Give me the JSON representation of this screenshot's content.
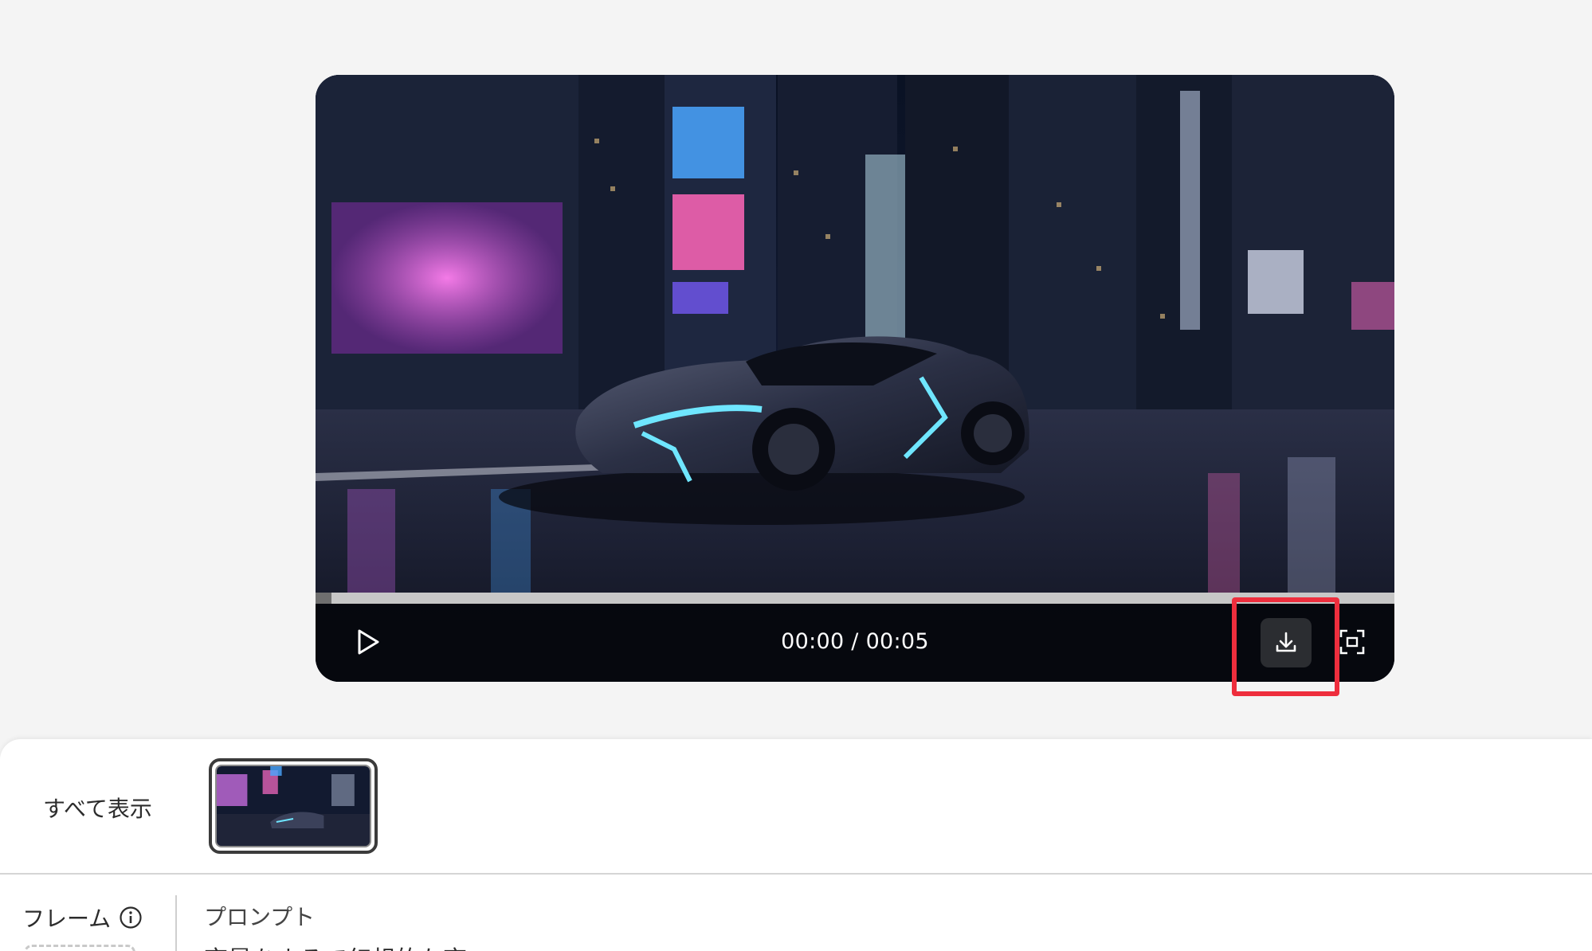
{
  "player": {
    "current_time": "00:00",
    "duration": "00:05",
    "time_separator": " / ",
    "time_display": "00:00 / 00:05",
    "progress": 0.015,
    "icons": {
      "play": "play-icon",
      "download": "download-icon",
      "fullscreen": "fullscreen-icon"
    }
  },
  "highlight": {
    "target": "download-button",
    "color": "#ee2e3d"
  },
  "panel": {
    "show_all_label": "すべて表示",
    "frame_label": "フレーム",
    "prompt_label": "プロンプト",
    "prompt_text": "夜景をまるで幻想的な夜"
  },
  "colors": {
    "background": "#f4f4f4",
    "panel": "#ffffff",
    "control_bar": "#06080e",
    "download_button": "#2b2d31"
  }
}
